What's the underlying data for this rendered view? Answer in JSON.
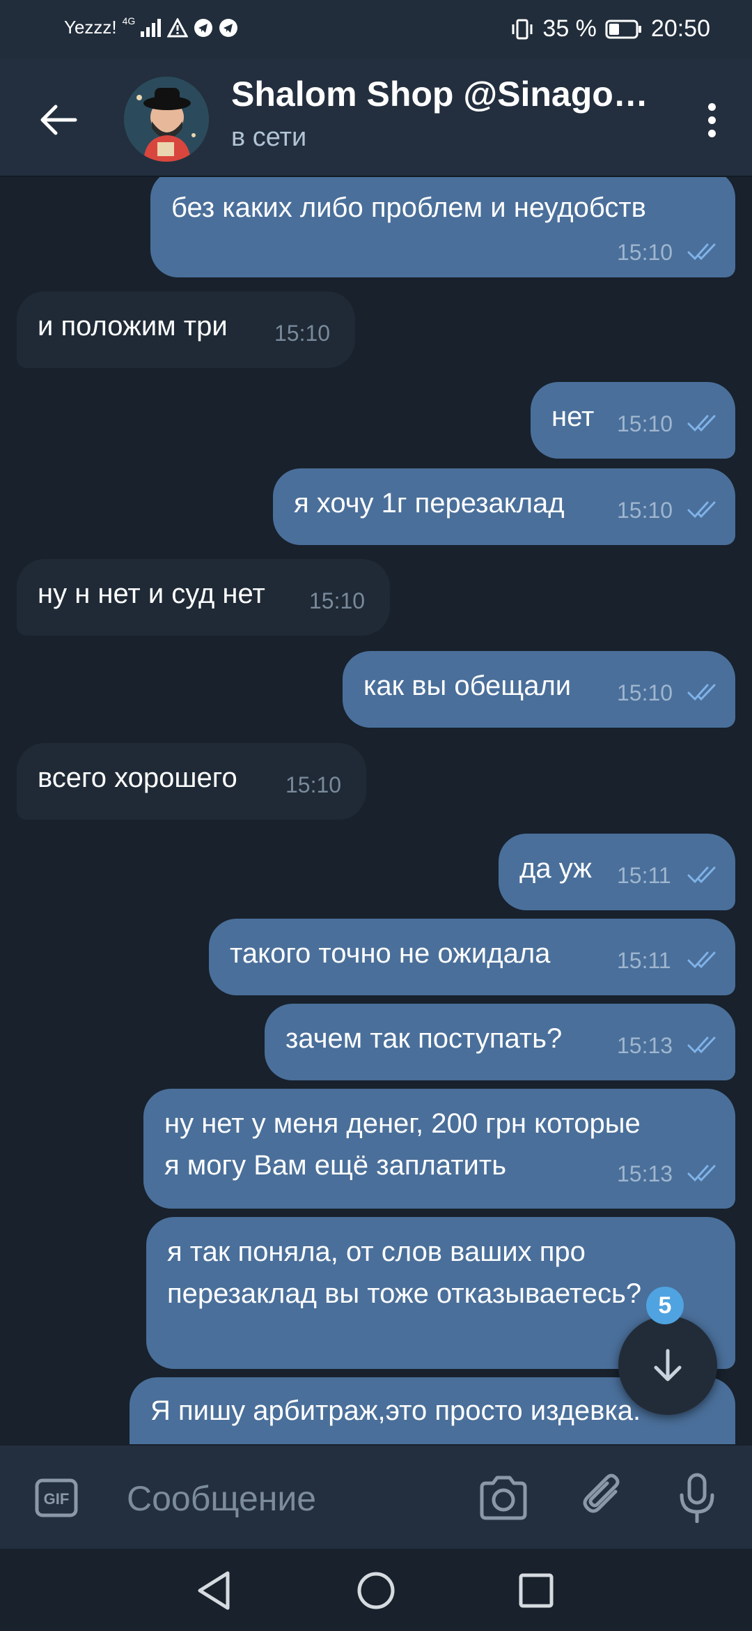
{
  "status_bar": {
    "carrier": "Yezzz!",
    "network": "4G",
    "battery": "35 %",
    "time": "20:50"
  },
  "header": {
    "title": "Shalom Shop @Sinago…",
    "status": "в сети"
  },
  "messages": [
    {
      "dir": "out",
      "text": "без каких либо проблем и неудобств",
      "time": "15:10"
    },
    {
      "dir": "in",
      "text": "и положим три",
      "time": "15:10"
    },
    {
      "dir": "out",
      "text": "нет",
      "time": "15:10"
    },
    {
      "dir": "out",
      "text": "я хочу 1г перезаклад",
      "time": "15:10"
    },
    {
      "dir": "in",
      "text": "ну н нет и суд нет",
      "time": "15:10"
    },
    {
      "dir": "out",
      "text": "как вы обещали",
      "time": "15:10"
    },
    {
      "dir": "in",
      "text": "всего хорошего",
      "time": "15:10"
    },
    {
      "dir": "out",
      "text": "да уж",
      "time": "15:11"
    },
    {
      "dir": "out",
      "text": "такого точно не ожидала",
      "time": "15:11"
    },
    {
      "dir": "out",
      "text": "зачем так поступать?",
      "time": "15:13"
    },
    {
      "dir": "out",
      "line1": "ну нет у меня денег, 200 грн которые",
      "line2": "я могу Вам ещё заплатить",
      "time": "15:13"
    },
    {
      "dir": "out",
      "line1": "я так поняла, от слов ваших про",
      "line2": "перезаклад вы тоже отказываетесь?"
    },
    {
      "dir": "out",
      "text": "Я пишу арбитраж,это просто издевка."
    }
  ],
  "scroll": {
    "unread_count": "5"
  },
  "composer": {
    "placeholder": "Сообщение"
  },
  "colors": {
    "background": "#18212c",
    "header": "#232f3e",
    "outgoing_bubble": "#4a6f9a",
    "incoming_bubble": "#1f2a36",
    "check_marks": "#7fb2e8",
    "badge": "#4fa3e0"
  },
  "icons": {
    "back": "arrow-left-icon",
    "menu": "more-vertical-icon",
    "gif": "gif-icon",
    "camera": "camera-icon",
    "attach": "paperclip-icon",
    "mic": "microphone-icon",
    "scroll_down": "arrow-down-icon",
    "nav_back": "triangle-back-icon",
    "nav_home": "circle-home-icon",
    "nav_recent": "square-recent-icon"
  }
}
